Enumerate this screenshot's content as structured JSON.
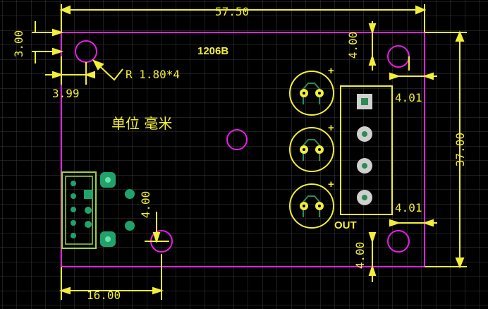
{
  "board": {
    "part_name": "1206B",
    "unit_note": "单位 毫米",
    "hole_note": "R 1.80*4",
    "connector_label": "OUT",
    "capacitor_polarity": "+"
  },
  "dimensions": {
    "width": "57.50",
    "height": "37.00",
    "top_margin": "3.00",
    "left_margin": "3.99",
    "right_top": "4.00",
    "right_bottom": "4.00",
    "header_top": "4.01",
    "header_bottom": "4.01",
    "mid_left": "4.00",
    "bottom_left": "16.00"
  },
  "colors": {
    "background": "#000000",
    "grid": "#3c3c3c",
    "outline": "#e51ee5",
    "dimension": "#f2ee3a",
    "pad": "#2e8b57"
  }
}
